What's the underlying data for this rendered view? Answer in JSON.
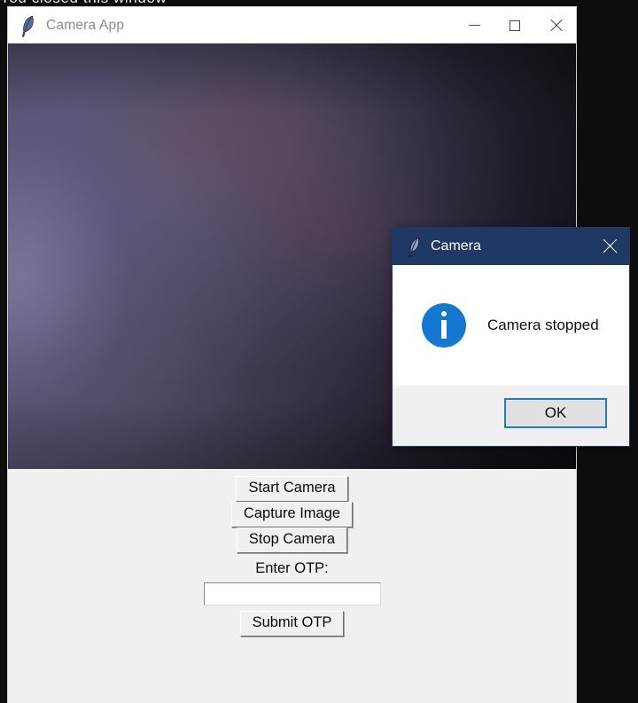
{
  "desktop": {
    "background_color": "#0d0d0e",
    "cut_off_text": "You closed this window"
  },
  "app_window": {
    "icon": "feather-icon",
    "title": "Camera App",
    "window_controls": {
      "minimize": "minimize-icon",
      "maximize": "maximize-icon",
      "close": "close-icon"
    },
    "camera_preview": {
      "name": "camera-preview",
      "state": "dark video frame"
    },
    "controls": {
      "start_camera_label": "Start Camera",
      "capture_image_label": "Capture Image",
      "stop_camera_label": "Stop Camera",
      "otp_label": "Enter OTP:",
      "otp_value": "",
      "otp_placeholder": "",
      "submit_otp_label": "Submit OTP"
    }
  },
  "dialog": {
    "icon": "feather-icon",
    "title": "Camera",
    "close": "close-icon",
    "message_icon": "info-icon",
    "message": "Camera stopped",
    "ok_label": "OK",
    "titlebar_color": "#1f3864",
    "info_icon_color": "#1379d0",
    "focus_border_color": "#1d7ec4"
  }
}
